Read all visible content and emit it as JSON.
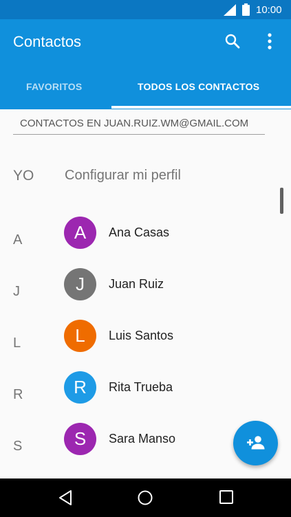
{
  "status_bar": {
    "time": "10:00",
    "signal_icon": "signal-icon",
    "battery_icon": "battery-icon"
  },
  "app_bar": {
    "title": "Contactos",
    "search_icon": "search-icon",
    "menu_icon": "more-vert-icon"
  },
  "tabs": [
    {
      "label": "FAVORITOS",
      "selected": false
    },
    {
      "label": "TODOS LOS CONTACTOS",
      "selected": true
    }
  ],
  "account_header": "CONTACTOS EN JUAN.RUIZ.WM@GMAIL.COM",
  "me_row": {
    "letter": "YO",
    "label": "Configurar mi perfil"
  },
  "contacts": [
    {
      "letter": "A",
      "initial": "A",
      "name": "Ana Casas",
      "color": "#9c27b0"
    },
    {
      "letter": "J",
      "initial": "J",
      "name": "Juan Ruiz",
      "color": "#757575"
    },
    {
      "letter": "L",
      "initial": "L",
      "name": "Luis Santos",
      "color": "#ef6c00"
    },
    {
      "letter": "R",
      "initial": "R",
      "name": "Rita Trueba",
      "color": "#1e9be6"
    },
    {
      "letter": "S",
      "initial": "S",
      "name": "Sara Manso",
      "color": "#9c27b0"
    }
  ],
  "fab": {
    "icon": "add-person-icon"
  },
  "nav_bar": {
    "back_icon": "back-icon",
    "home_icon": "home-icon",
    "recents_icon": "recents-icon"
  },
  "colors": {
    "primary": "#1090dc",
    "status_bar": "#0b77c2"
  }
}
